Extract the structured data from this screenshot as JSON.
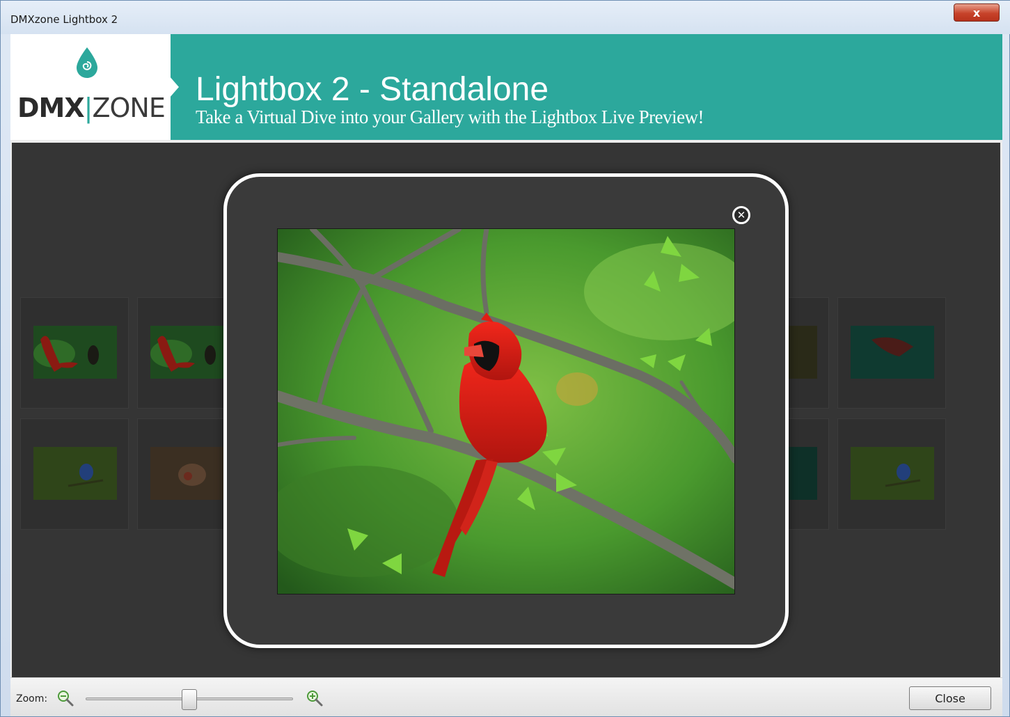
{
  "window": {
    "title": "DMXzone Lightbox 2",
    "close_glyph": "x"
  },
  "banner": {
    "logo": {
      "left": "DMX",
      "separator": "|",
      "right": "ZONE"
    },
    "title": "Lightbox 2 - Standalone",
    "subtitle": "Take a Virtual Dive into your Gallery with the Lightbox Live Preview!",
    "accent_color": "#2ca89c"
  },
  "gallery": {
    "thumbnails": [
      {
        "subject": "hummingbird-flowers"
      },
      {
        "subject": "hummingbird-flowers"
      },
      {
        "subject": "dark-forest"
      },
      {
        "subject": "red-bird-dark"
      },
      {
        "subject": "bluebird-branch"
      },
      {
        "subject": "finches-brown"
      },
      {
        "subject": "dark-teal"
      },
      {
        "subject": "bluebird-branch"
      }
    ]
  },
  "lightbox": {
    "close_glyph": "✕",
    "photo_subject": "northern-cardinal-on-branch"
  },
  "statusbar": {
    "zoom_label": "Zoom:",
    "zoom_level": 0.5,
    "close_label": "Close"
  }
}
